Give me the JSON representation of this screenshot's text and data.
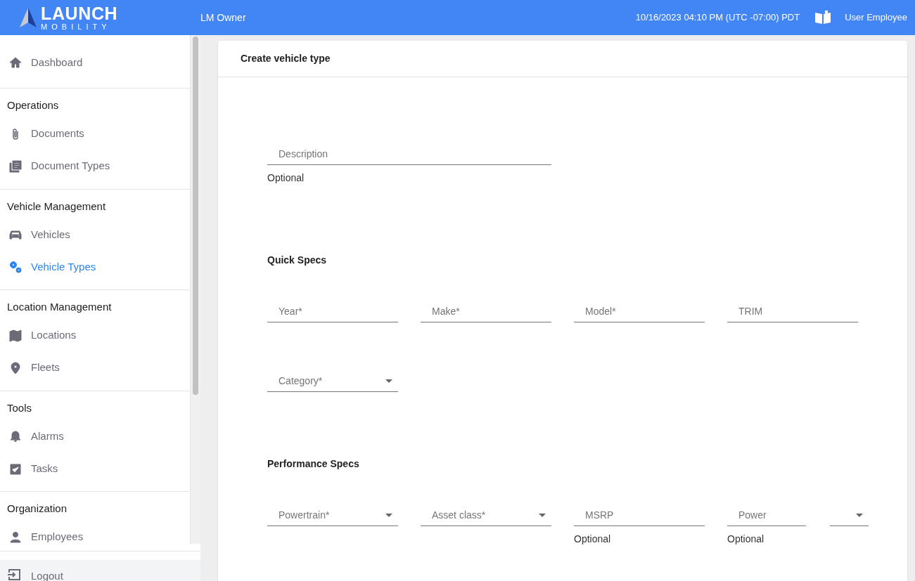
{
  "header": {
    "logo_top": "LAUNCH",
    "logo_bottom": "MOBILITY",
    "organization": "LM Owner",
    "datetime": "10/16/2023 04:10 PM (UTC -07:00) PDT",
    "user": "User Employee"
  },
  "sidebar": {
    "sections": [
      {
        "items": [
          {
            "label": "Dashboard",
            "selected": false
          }
        ]
      },
      {
        "heading": "Operations",
        "items": [
          {
            "label": "Documents",
            "selected": false
          },
          {
            "label": "Document Types",
            "selected": false
          }
        ]
      },
      {
        "heading": "Vehicle Management",
        "items": [
          {
            "label": "Vehicles",
            "selected": false
          },
          {
            "label": "Vehicle Types",
            "selected": true
          }
        ]
      },
      {
        "heading": "Location Management",
        "items": [
          {
            "label": "Locations",
            "selected": false
          },
          {
            "label": "Fleets",
            "selected": false
          }
        ]
      },
      {
        "heading": "Tools",
        "items": [
          {
            "label": "Alarms",
            "selected": false
          },
          {
            "label": "Tasks",
            "selected": false
          }
        ]
      },
      {
        "heading": "Organization",
        "items": [
          {
            "label": "Employees",
            "selected": false
          }
        ]
      }
    ],
    "logout": "Logout"
  },
  "card": {
    "title": "Create vehicle type",
    "description": {
      "kind": "text",
      "label": "Description",
      "helper": "Optional"
    },
    "sections": [
      {
        "title": "Quick Specs",
        "rows": [
          [
            {
              "kind": "text",
              "label": "Year*"
            },
            {
              "kind": "text",
              "label": "Make*"
            },
            {
              "kind": "text",
              "label": "Model*"
            },
            {
              "kind": "text",
              "label": "TRIM"
            }
          ],
          [
            {
              "kind": "select",
              "label": "Category*"
            }
          ]
        ]
      },
      {
        "title": "Performance Specs",
        "rows": [
          [
            {
              "kind": "select",
              "label": "Powertrain*"
            },
            {
              "kind": "select",
              "label": "Asset class*"
            },
            {
              "kind": "text",
              "label": "MSRP",
              "helper": "Optional"
            },
            {
              "kind": "text",
              "label": "Power",
              "helper": "Optional",
              "unit": {
                "kind": "select"
              }
            }
          ]
        ]
      }
    ]
  }
}
